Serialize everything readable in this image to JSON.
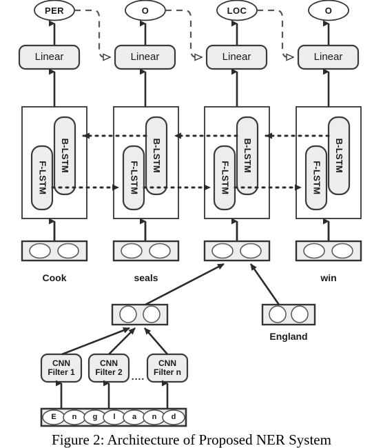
{
  "figure": {
    "caption": "Figure 2: Architecture of Proposed NER System",
    "colors": {
      "node_fill": "#ededed",
      "stroke": "#333333",
      "text": "#1a1a1a",
      "background": "#ffffff"
    }
  },
  "output_tags": [
    {
      "label": "PER"
    },
    {
      "label": "O"
    },
    {
      "label": "LOC"
    },
    {
      "label": "O"
    }
  ],
  "linear_layers": [
    {
      "label": "Linear"
    },
    {
      "label": "Linear"
    },
    {
      "label": "Linear"
    },
    {
      "label": "Linear"
    }
  ],
  "lstm_cells": [
    {
      "backward": "B-LSTM",
      "forward": "F-LSTM"
    },
    {
      "backward": "B-LSTM",
      "forward": "F-LSTM"
    },
    {
      "backward": "B-LSTM",
      "forward": "F-LSTM"
    },
    {
      "backward": "B-LSTM",
      "forward": "F-LSTM"
    }
  ],
  "words": [
    {
      "label": "Cook"
    },
    {
      "label": "seals"
    },
    {
      "label": ""
    },
    {
      "label": "win"
    }
  ],
  "char_cnn": {
    "output_embedding": {
      "label": ""
    },
    "filters": [
      {
        "line1": "CNN",
        "line2": "Filter 1"
      },
      {
        "line1": "CNN",
        "line2": "Filter 2"
      },
      {
        "line1": "CNN",
        "line2": "Filter n"
      }
    ],
    "filters_ellipsis": "....",
    "characters": [
      "E",
      "n",
      "g",
      "l",
      "a",
      "n",
      "d"
    ]
  },
  "word_embedding_extra": {
    "label": "England"
  }
}
